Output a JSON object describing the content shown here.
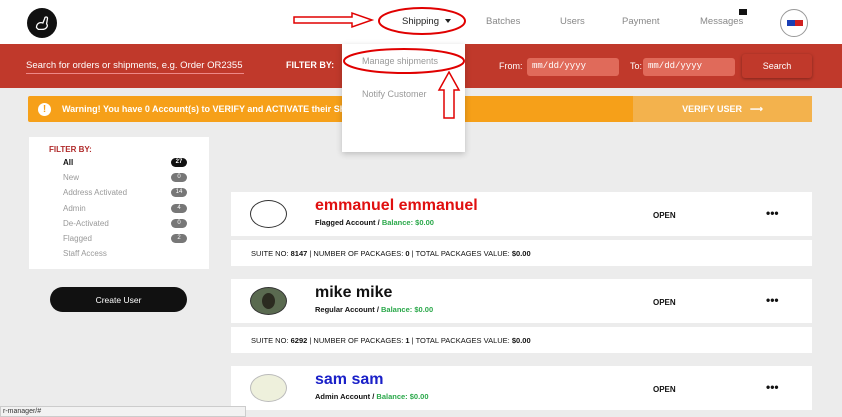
{
  "nav": {
    "shipping": "Shipping",
    "batches": "Batches",
    "users": "Users",
    "payment": "Payment",
    "messages": "Messages"
  },
  "search": {
    "placeholder": "Search for orders or shipments, e.g. Order OR2355",
    "filter_by": "FILTER BY:",
    "from_label": "From:",
    "from_value": "mm/dd/yyyy",
    "to_label": "To:",
    "to_value": "mm/dd/yyyy",
    "search_button": "Search"
  },
  "warning": {
    "icon": "!",
    "text": "Warning! You have 0 Account(s) to VERIFY and ACTIVATE their Shipping",
    "verify_button": "VERIFY USER",
    "verify_arrow": "⟶"
  },
  "dropdown": {
    "manage": "Manage shipments",
    "notify": "Notify Customer"
  },
  "filters": {
    "title": "FILTER BY:",
    "items": [
      {
        "label": "All",
        "count": "27"
      },
      {
        "label": "New",
        "count": "0"
      },
      {
        "label": "Address Activated",
        "count": "14"
      },
      {
        "label": "Admin",
        "count": "4"
      },
      {
        "label": "De-Activated",
        "count": "0"
      },
      {
        "label": "Flagged",
        "count": "2"
      },
      {
        "label": "Staff Access",
        "count": ""
      }
    ]
  },
  "create_user": "Create User",
  "users": [
    {
      "name": "emmanuel emmanuel",
      "name_color": "#e01010",
      "account": "Flagged Account /",
      "balance": "Balance: $0.00",
      "status": "OPEN",
      "more": "•••",
      "suite_label": "SUITE NO:",
      "suite": "8147",
      "packages_label": "NUMBER OF PACKAGES:",
      "packages": "0",
      "value_label": "TOTAL PACKAGES VALUE:",
      "value": "$0.00"
    },
    {
      "name": "mike mike",
      "name_color": "#111111",
      "account": "Regular Account /",
      "balance": "Balance: $0.00",
      "status": "OPEN",
      "more": "•••",
      "suite_label": "SUITE NO:",
      "suite": "6292",
      "packages_label": "NUMBER OF PACKAGES:",
      "packages": "1",
      "value_label": "TOTAL PACKAGES VALUE:",
      "value": "$0.00"
    },
    {
      "name": "sam sam",
      "name_color": "#1a20c8",
      "account": "Admin Account /",
      "balance": "Balance: $0.00",
      "status": "OPEN",
      "more": "•••"
    }
  ],
  "status_url": "r-manager/#",
  "colors": {
    "brand_red": "#c0392b",
    "warning_orange": "#f6a019",
    "balance_green": "#2aa84a",
    "annotation_red": "#e00000"
  },
  "icons": {
    "logo": "goose-logo-icon",
    "mail": "mail-icon",
    "warning": "exclamation-icon",
    "more": "more-dots-icon"
  }
}
